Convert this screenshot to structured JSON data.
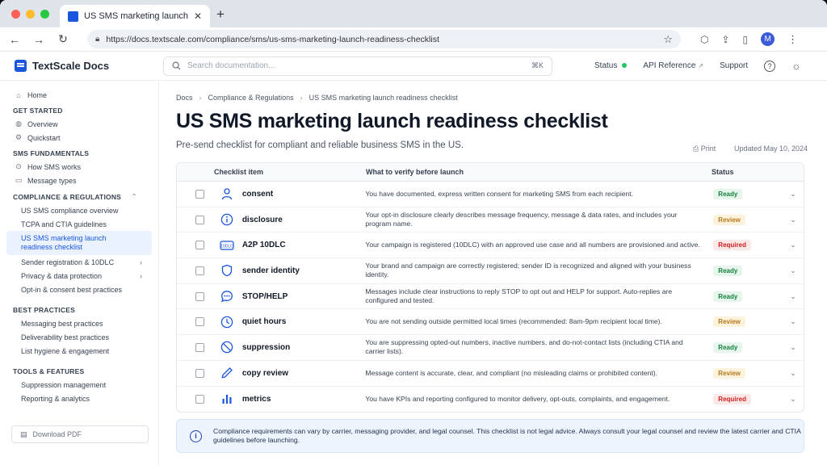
{
  "browser": {
    "tab_title": "US SMS marketing launch readin",
    "url": "https://docs.textscale.com/compliance/sms/us-sms-marketing-launch-readiness-checklist",
    "avatar_initial": "M"
  },
  "header": {
    "brand": "TextScale Docs",
    "search_placeholder": "Search documentation...",
    "search_shortcut": "⌘K",
    "status_label": "Status",
    "api_label": "API Reference",
    "support_label": "Support"
  },
  "sidebar": {
    "home": "Home",
    "sections": [
      {
        "heading": "GET STARTED",
        "items": [
          "Overview",
          "Quickstart"
        ]
      },
      {
        "heading": "SMS FUNDAMENTALS",
        "items": [
          "How SMS works",
          "Message types"
        ]
      },
      {
        "heading": "COMPLIANCE & REGULATIONS",
        "items": [
          "US SMS compliance overview",
          "TCPA and CTIA guidelines",
          "US SMS marketing launch readiness checklist",
          "Sender registration & 10DLC",
          "Privacy & data protection",
          "Opt-in & consent best practices"
        ]
      },
      {
        "heading": "BEST PRACTICES",
        "items": [
          "Messaging best practices",
          "Deliverability best practices",
          "List hygiene & engagement"
        ]
      },
      {
        "heading": "TOOLS & FEATURES",
        "items": [
          "Suppression management",
          "Reporting & analytics"
        ]
      }
    ],
    "download": "Download PDF"
  },
  "main": {
    "breadcrumb": [
      "Docs",
      "Compliance & Regulations",
      "US SMS marketing launch readiness checklist"
    ],
    "title": "US SMS marketing launch readiness checklist",
    "subtitle": "Pre-send checklist for compliant and reliable business SMS in the US.",
    "print": "Print",
    "updated": "Updated May 10, 2024",
    "table": {
      "headers": [
        "Checklist item",
        "What to verify before launch",
        "Status"
      ],
      "rows": [
        {
          "icon": "person-icon",
          "item": "consent",
          "desc": "You have documented, express written consent for marketing SMS from each recipient.",
          "status": "Ready"
        },
        {
          "icon": "info-circle-icon",
          "item": "disclosure",
          "desc": "Your opt-in disclosure clearly describes message frequency, message & data rates, and includes your program name.",
          "status": "Review"
        },
        {
          "icon": "10dlc-icon",
          "item": "A2P 10DLC",
          "desc": "Your campaign is registered (10DLC) with an approved use case and all numbers are provisioned and active.",
          "status": "Required"
        },
        {
          "icon": "shield-icon",
          "item": "sender identity",
          "desc": "Your brand and campaign are correctly registered; sender ID is recognized and aligned with your business identity.",
          "status": "Ready"
        },
        {
          "icon": "chat-bubble-icon",
          "item": "STOP/HELP",
          "desc": "Messages include clear instructions to reply STOP to opt out and HELP for support. Auto-replies are configured and tested.",
          "status": "Ready"
        },
        {
          "icon": "clock-icon",
          "item": "quiet hours",
          "desc": "You are not sending outside permitted local times (recommended: 8am-9pm recipient local time).",
          "status": "Review"
        },
        {
          "icon": "block-icon",
          "item": "suppression",
          "desc": "You are suppressing opted-out numbers, inactive numbers, and do-not-contact lists (including CTIA and carrier lists).",
          "status": "Ready"
        },
        {
          "icon": "pencil-icon",
          "item": "copy review",
          "desc": "Message content is accurate, clear, and compliant (no misleading claims or prohibited content).",
          "status": "Review"
        },
        {
          "icon": "bar-chart-icon",
          "item": "metrics",
          "desc": "You have KPIs and reporting configured to monitor delivery, opt-outs, complaints, and engagement.",
          "status": "Required"
        }
      ]
    },
    "callout": "Compliance requirements can vary by carrier, messaging provider, and legal counsel. This checklist is not legal advice. Always consult your legal counsel and review the latest carrier and CTIA guidelines before launching."
  },
  "colors": {
    "accent": "#1a56db",
    "ready": "#15803d",
    "review": "#b7791f",
    "required": "#c81e1e"
  }
}
